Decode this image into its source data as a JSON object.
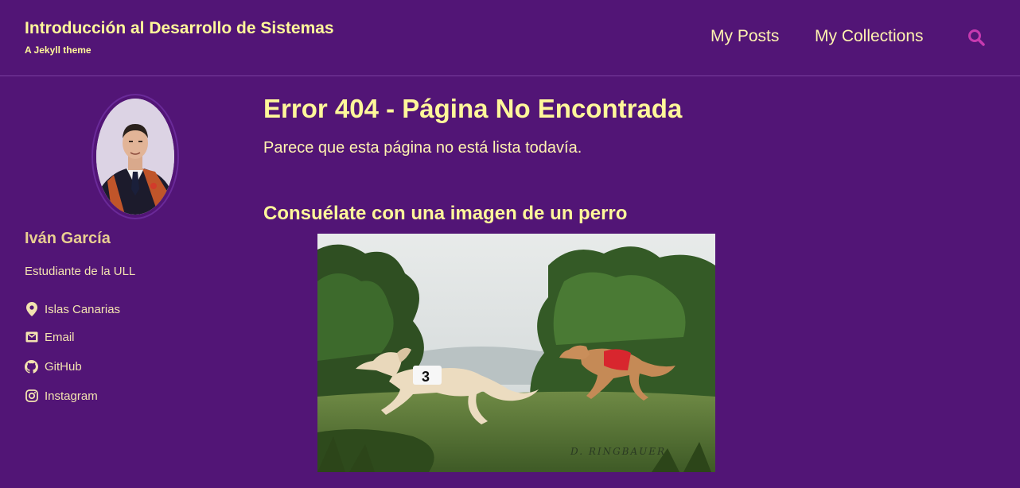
{
  "header": {
    "site_title": "Introducción al Desarrollo de Sistemas",
    "site_subtitle": "A Jekyll theme",
    "nav": [
      {
        "label": "My Posts"
      },
      {
        "label": "My Collections"
      }
    ],
    "search_icon": "search-icon"
  },
  "sidebar": {
    "author_name": "Iván García",
    "author_bio": "Estudiante de la ULL",
    "links": [
      {
        "icon": "map-marker-icon",
        "label": "Islas Canarias"
      },
      {
        "icon": "envelope-icon",
        "label": "Email"
      },
      {
        "icon": "github-icon",
        "label": "GitHub"
      },
      {
        "icon": "instagram-icon",
        "label": "Instagram"
      }
    ]
  },
  "main": {
    "title": "Error 404 - Página No Encontrada",
    "lead": "Parece que esta página no está lista todavía.",
    "section_title": "Consuélate con una imagen de un perro",
    "image": {
      "bib_number": "3",
      "watermark": "D. RINGBAUER"
    }
  },
  "colors": {
    "background": "#521576",
    "title": "#fff79a",
    "accent": "#c73ab0"
  }
}
